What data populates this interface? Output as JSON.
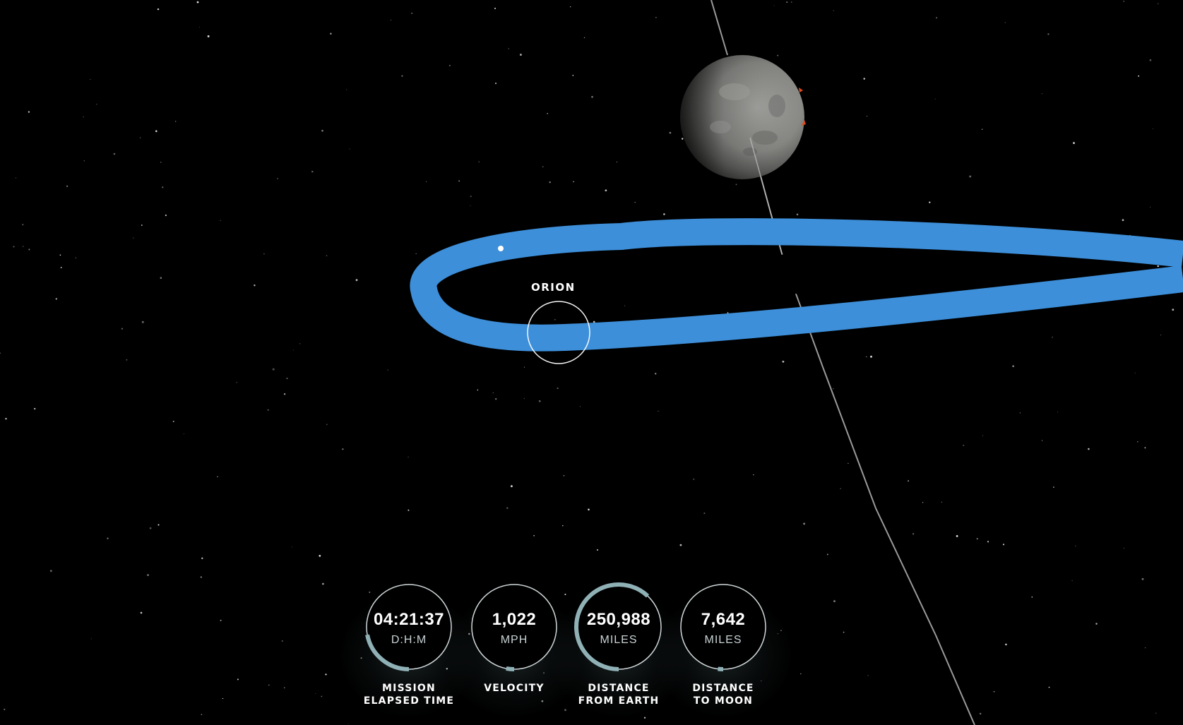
{
  "orion_label": "ORION",
  "colors": {
    "trajectory": "#3d8fda",
    "background": "#000000",
    "gauge_ring": "#d0d8da",
    "gauge_arc": "#8fb1b6",
    "moon_accent": "#e24a1c"
  },
  "gauges": [
    {
      "value": "04:21:37",
      "unit": "D:H:M",
      "caption_line1": "MISSION",
      "caption_line2": "ELAPSED TIME",
      "arc_fraction": 0.22
    },
    {
      "value": "1,022",
      "unit": "MPH",
      "caption_line1": "VELOCITY",
      "caption_line2": "",
      "arc_fraction": 0.03
    },
    {
      "value": "250,988",
      "unit": "MILES",
      "caption_line1": "DISTANCE",
      "caption_line2": "FROM EARTH",
      "arc_fraction": 0.62
    },
    {
      "value": "7,642",
      "unit": "MILES",
      "caption_line1": "DISTANCE",
      "caption_line2": "TO MOON",
      "arc_fraction": 0.02
    }
  ]
}
